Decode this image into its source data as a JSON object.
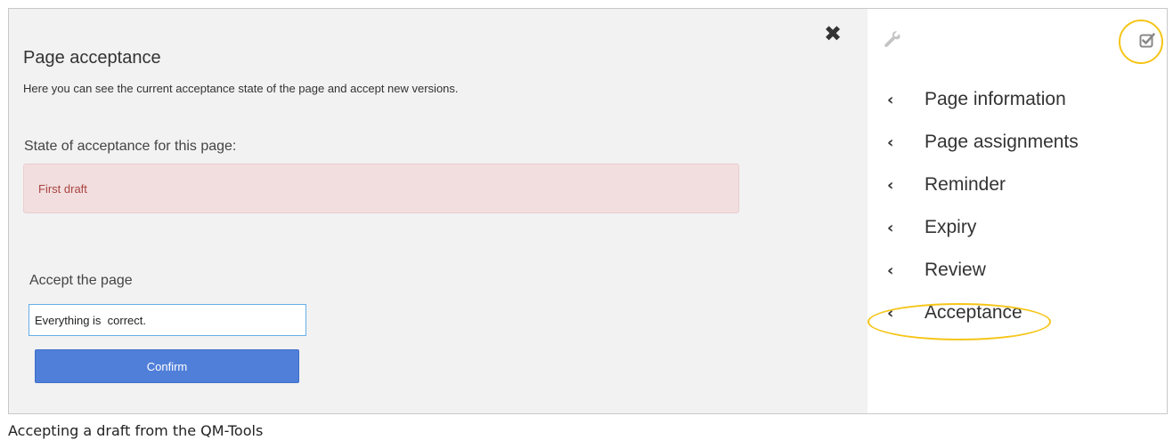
{
  "dialog": {
    "close_icon": "close-icon",
    "title": "Page acceptance",
    "subtitle": "Here you can see the current acceptance state of the page and accept new versions.",
    "state_heading": "State of acceptance for this page:",
    "state_value": "First draft",
    "accept_heading": "Accept the page",
    "comment_value": "Everything is  correct.",
    "confirm_label": "Confirm"
  },
  "sidebar": {
    "tool_icon": "wrench-icon",
    "status_icon": "checkbox-icon",
    "items": [
      {
        "label": "Page information",
        "icon": "chevron-left-icon"
      },
      {
        "label": "Page assignments",
        "icon": "chevron-left-icon"
      },
      {
        "label": "Reminder",
        "icon": "chevron-left-icon"
      },
      {
        "label": "Expiry",
        "icon": "chevron-left-icon"
      },
      {
        "label": "Review",
        "icon": "chevron-left-icon"
      },
      {
        "label": "Acceptance",
        "icon": "chevron-left-icon"
      }
    ]
  },
  "colors": {
    "highlight": "#f5c518",
    "alert_bg": "#f2dede",
    "alert_text": "#a94442",
    "primary_button": "#507fd9"
  },
  "caption": "Accepting a draft from the QM-Tools"
}
